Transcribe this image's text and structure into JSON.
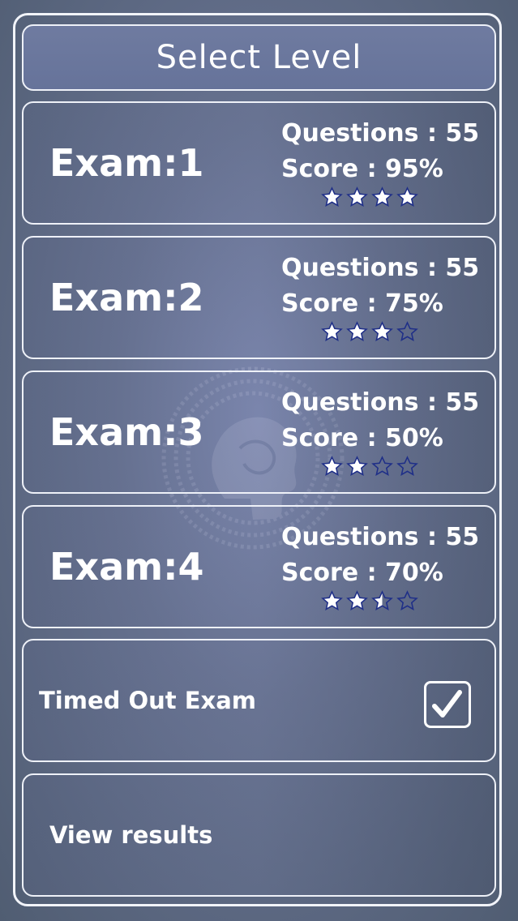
{
  "header": {
    "title": "Select Level"
  },
  "exams": [
    {
      "name": "Exam:1",
      "questions_text": "Questions : 55",
      "score_text": "Score : 95%",
      "rating": 4
    },
    {
      "name": "Exam:2",
      "questions_text": "Questions : 55",
      "score_text": "Score : 75%",
      "rating": 3
    },
    {
      "name": "Exam:3",
      "questions_text": "Questions : 55",
      "score_text": "Score : 50%",
      "rating": 2
    },
    {
      "name": "Exam:4",
      "questions_text": "Questions : 55",
      "score_text": "Score : 70%",
      "rating": 2.5
    }
  ],
  "timed_out": {
    "label": "Timed Out Exam",
    "checked": true
  },
  "results": {
    "label": "View results"
  },
  "colors": {
    "background": "#66718f",
    "border": "#eef1f8",
    "star_fill": "#ffffff",
    "star_outline": "#1f2f88"
  },
  "icons": {
    "watermark": "brain-head-icon",
    "rating": "star-icon",
    "checkmark": "checkmark-icon"
  }
}
